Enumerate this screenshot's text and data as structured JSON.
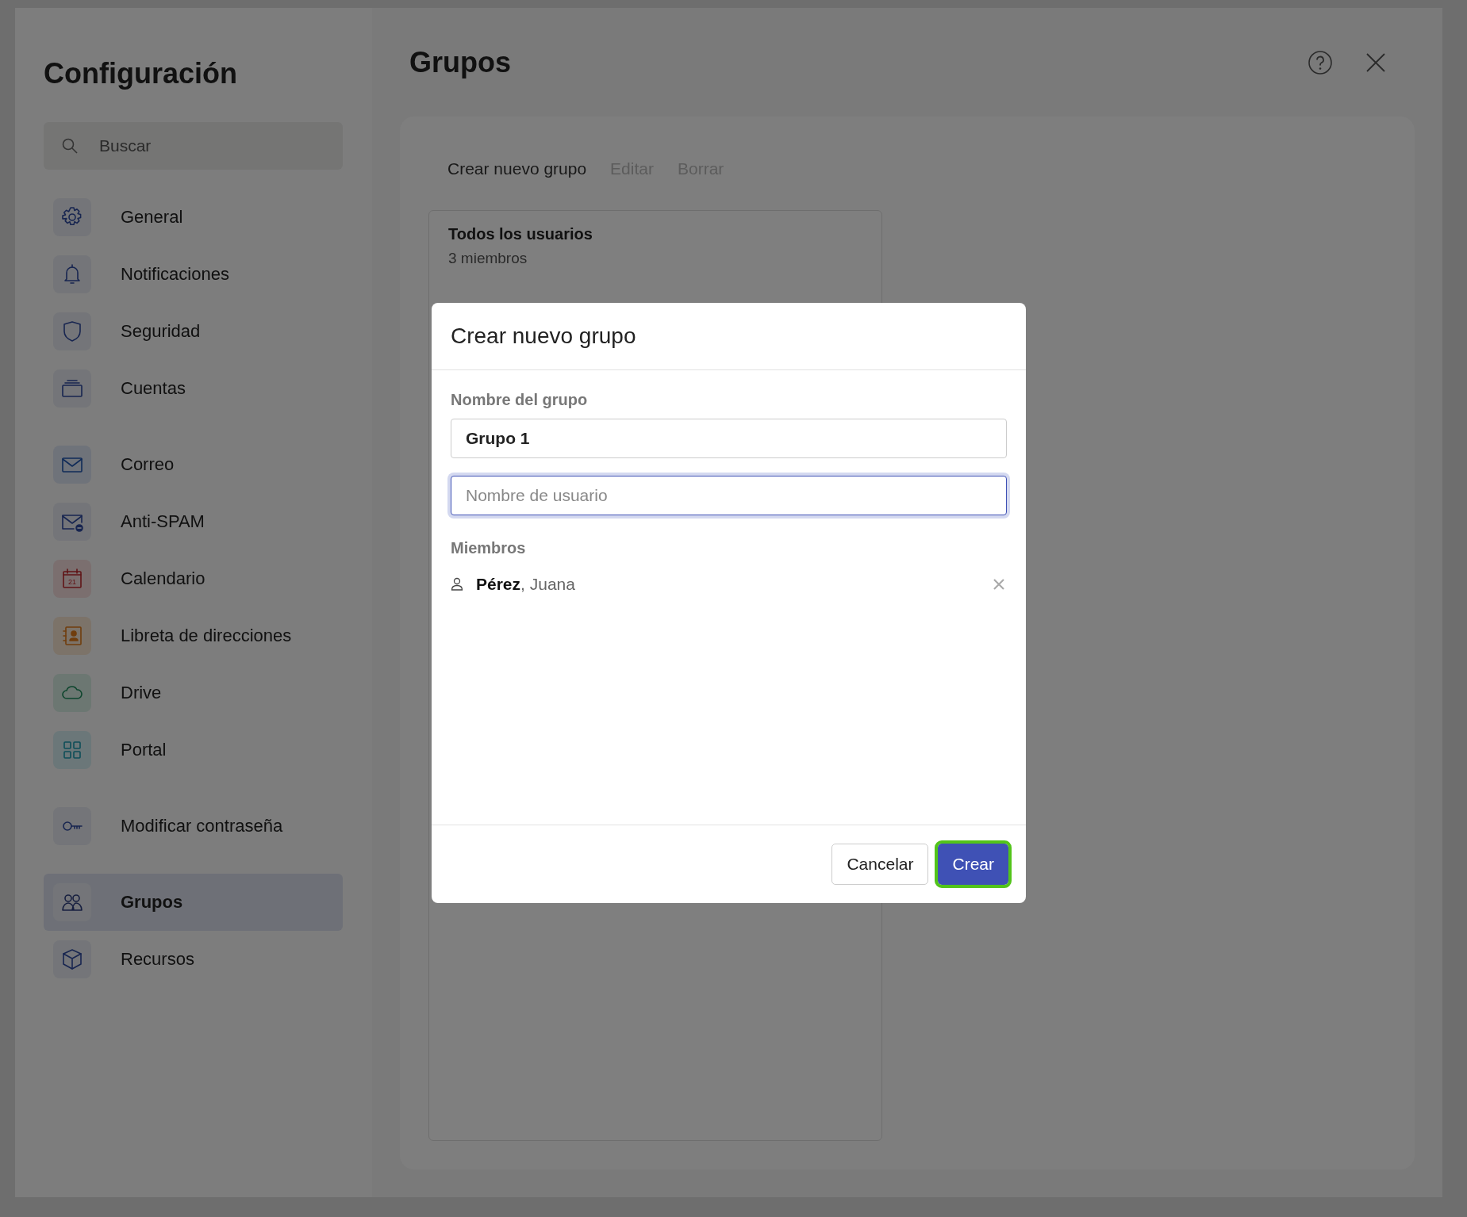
{
  "sidebar": {
    "title": "Configuración",
    "search": {
      "placeholder": "Buscar"
    },
    "groups": [
      [
        {
          "label": "General",
          "kind": "gear",
          "selected": false
        },
        {
          "label": "Notificaciones",
          "kind": "bell",
          "selected": false
        },
        {
          "label": "Seguridad",
          "kind": "shield",
          "selected": false
        },
        {
          "label": "Cuentas",
          "kind": "stack",
          "selected": false
        }
      ],
      [
        {
          "label": "Correo",
          "kind": "mail",
          "selected": false
        },
        {
          "label": "Anti-SPAM",
          "kind": "mailblock",
          "selected": false
        },
        {
          "label": "Calendario",
          "kind": "calendar",
          "icon_text": "21",
          "selected": false
        },
        {
          "label": "Libreta de direcciones",
          "kind": "contacts",
          "selected": false
        },
        {
          "label": "Drive",
          "kind": "cloud",
          "selected": false
        },
        {
          "label": "Portal",
          "kind": "grid",
          "selected": false
        }
      ],
      [
        {
          "label": "Modificar contraseña",
          "kind": "key",
          "selected": false
        }
      ],
      [
        {
          "label": "Grupos",
          "kind": "people",
          "selected": true
        },
        {
          "label": "Recursos",
          "kind": "cube",
          "selected": false
        }
      ]
    ]
  },
  "main": {
    "title": "Grupos",
    "actions": [
      {
        "label": "Crear nuevo grupo",
        "disabled": false
      },
      {
        "label": "Editar",
        "disabled": true
      },
      {
        "label": "Borrar",
        "disabled": true
      }
    ],
    "groups": [
      {
        "name": "Todos los usuarios",
        "count": "3 miembros"
      }
    ]
  },
  "dialog": {
    "title": "Crear nuevo grupo",
    "name_label": "Nombre del grupo",
    "name_value": "Grupo 1",
    "user_placeholder": "Nombre de usuario",
    "members_label": "Miembros",
    "members": [
      {
        "name": "**Pérez**, Juana"
      }
    ],
    "buttons": [
      {
        "label": "Cancelar",
        "kind": "secondary",
        "focused": false
      },
      {
        "label": "Crear",
        "kind": "primary",
        "focused": true
      }
    ]
  }
}
